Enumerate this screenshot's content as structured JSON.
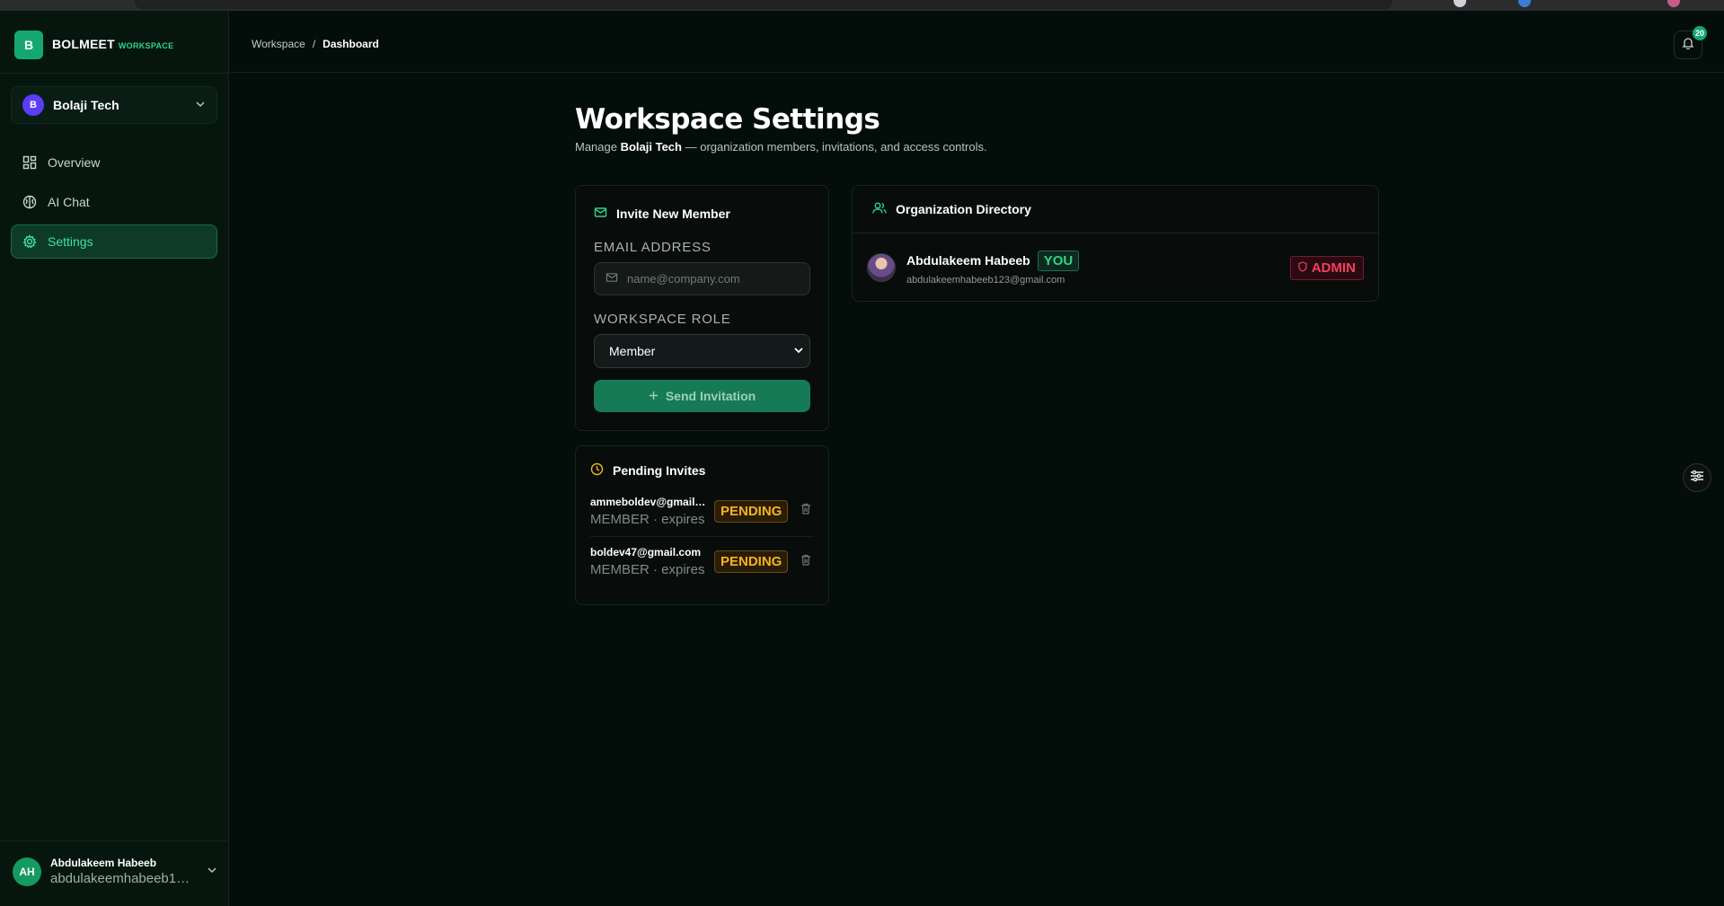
{
  "brand": {
    "logo_letter": "B",
    "name": "BOLMEET",
    "sub": "WORKSPACE",
    "accent": "#14a870"
  },
  "org": {
    "avatar_letter": "B",
    "name": "Bolaji Tech"
  },
  "nav": [
    {
      "label": "Overview",
      "icon": "grid-icon",
      "active": false
    },
    {
      "label": "AI Chat",
      "icon": "brain-icon",
      "active": false
    },
    {
      "label": "Settings",
      "icon": "gear-icon",
      "active": true
    }
  ],
  "user": {
    "initials": "AH",
    "name": "Abdulakeem Habeeb",
    "email": "abdulakeemhabeeb123@gmail.com"
  },
  "header": {
    "breadcrumb": [
      "Workspace",
      "/",
      "Dashboard"
    ],
    "notifications_count": "20"
  },
  "page": {
    "title": "Workspace Settings",
    "subtitle_prefix": "Manage ",
    "subtitle_org": "Bolaji Tech",
    "subtitle_suffix": " — organization members, invitations, and access controls."
  },
  "invite": {
    "title": "Invite New Member",
    "email_label": "EMAIL ADDRESS",
    "email_placeholder": "name@company.com",
    "role_label": "WORKSPACE ROLE",
    "role_value": "Member",
    "send_label": "Send Invitation"
  },
  "pending": {
    "title": "Pending Invites",
    "items": [
      {
        "email": "ammeboldev@gmail.com",
        "meta": "MEMBER · expires",
        "status": "PENDING"
      },
      {
        "email": "boldev47@gmail.com",
        "meta": "MEMBER · expires",
        "status": "PENDING"
      }
    ]
  },
  "directory": {
    "title": "Organization Directory",
    "members": [
      {
        "name": "Abdulakeem Habeeb",
        "you_badge": "YOU",
        "email": "abdulakeemhabeeb123@gmail.com",
        "role": "ADMIN"
      }
    ]
  },
  "colors": {
    "pending": "#f5b321",
    "admin": "#f43f5e",
    "you": "#2fd48d"
  }
}
